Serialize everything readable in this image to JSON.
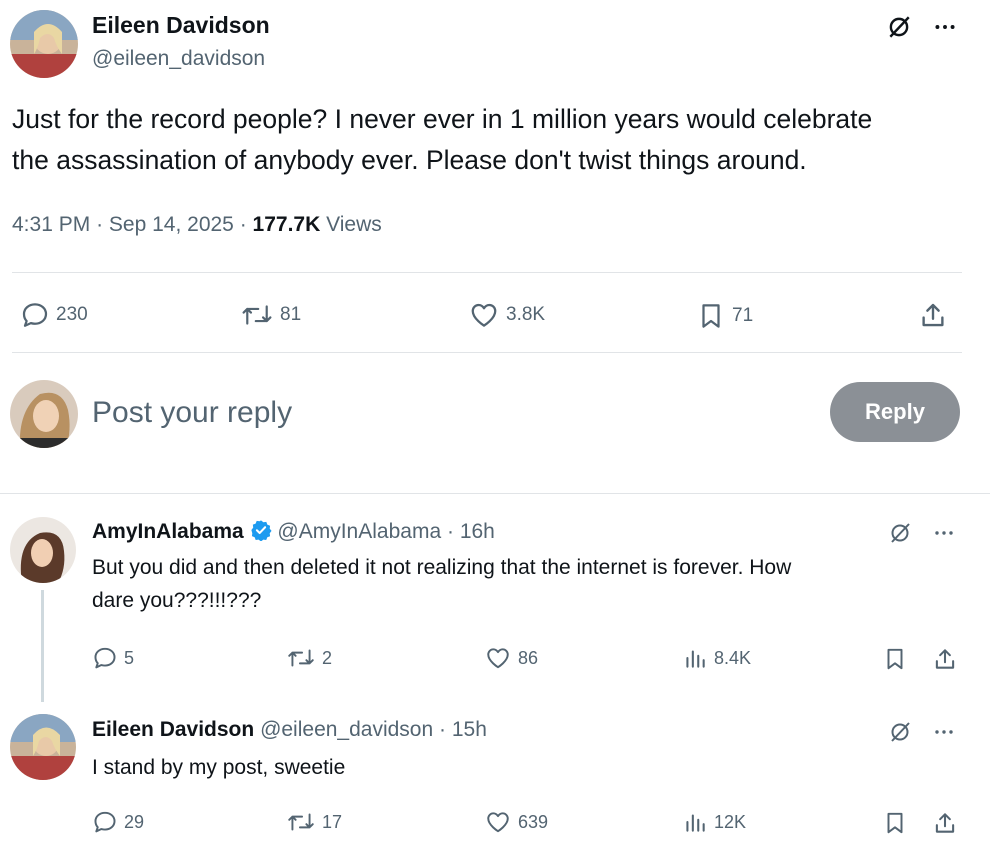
{
  "main_post": {
    "author_name": "Eileen Davidson",
    "author_handle": "@eileen_davidson",
    "text_line1": "Just for the record people? I never ever in 1 million years would celebrate",
    "text_line2": "the assassination of anybody ever. Please don't twist things around.",
    "time": "4:31 PM",
    "date": "Sep 14, 2025",
    "views_count": "177.7K",
    "views_label": "Views",
    "replies": "230",
    "reposts": "81",
    "likes": "3.8K",
    "bookmarks": "71"
  },
  "composer": {
    "placeholder": "Post your reply",
    "button_label": "Reply"
  },
  "replies": [
    {
      "author_name": "AmyInAlabama",
      "author_handle": "@AmyInAlabama",
      "age": "16h",
      "text_line1": "But you did and then deleted it not realizing that the internet is forever. How",
      "text_line2": "dare you???!!!???",
      "replies": "5",
      "reposts": "2",
      "likes": "86",
      "views": "8.4K"
    },
    {
      "author_name": "Eileen Davidson",
      "author_handle": "@eileen_davidson",
      "age": "15h",
      "text_line1": "I stand by my post, sweetie",
      "replies": "29",
      "reposts": "17",
      "likes": "639",
      "views": "12K"
    }
  ],
  "separator": "·",
  "colors": {
    "muted": "#536471",
    "verified": "#1d9bf0",
    "reply_button": "#8b9096"
  },
  "icons": [
    "grok-icon",
    "more-icon",
    "reply-icon",
    "repost-icon",
    "like-icon",
    "bookmark-icon",
    "share-icon",
    "views-icon",
    "verified-icon"
  ]
}
